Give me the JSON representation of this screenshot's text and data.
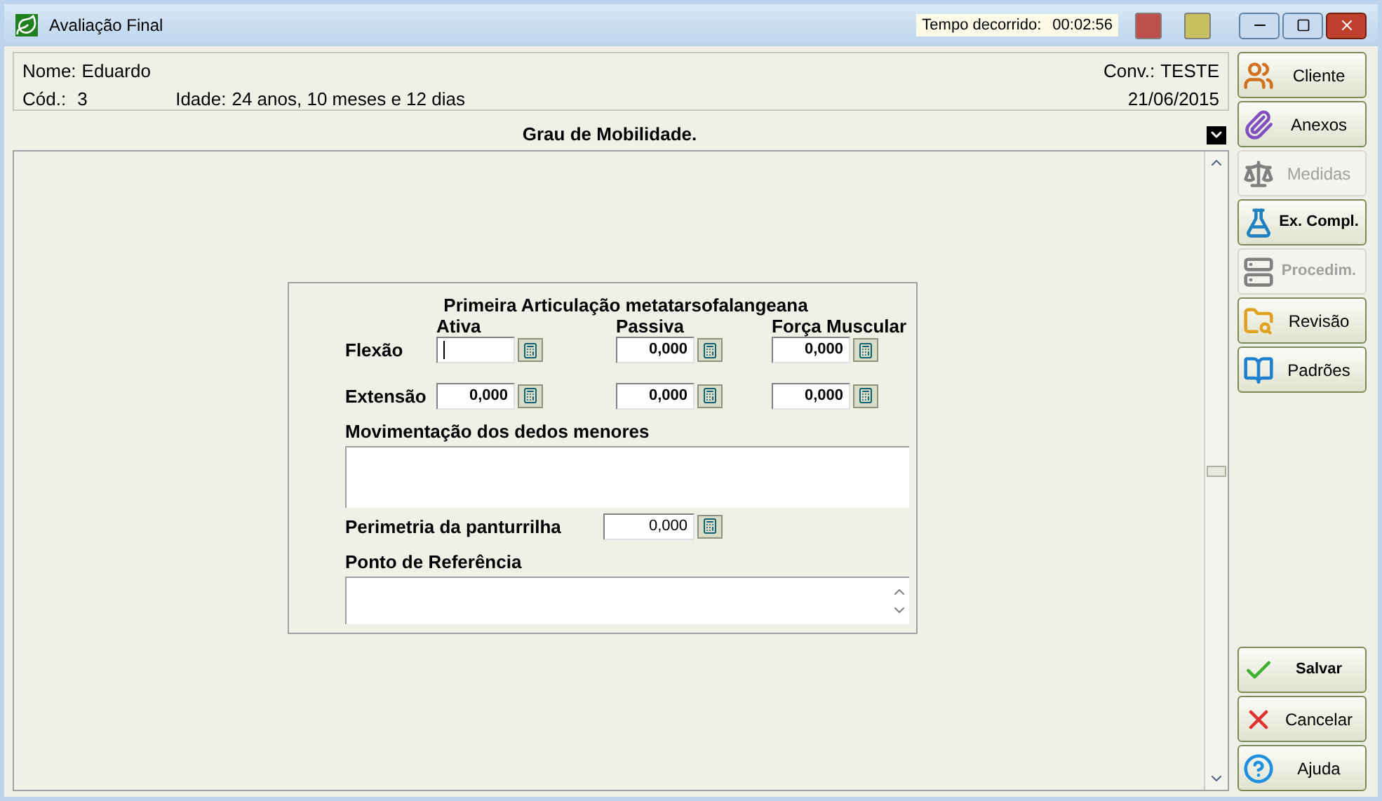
{
  "window": {
    "title": "Avaliação Final"
  },
  "timer": {
    "label": "Tempo decorrido:",
    "value": "00:02:56"
  },
  "indicators": [
    {
      "color": "#c0504d"
    },
    {
      "color": "#c8c060"
    }
  ],
  "patient": {
    "name_label": "Nome:",
    "name": "Eduardo",
    "code_label": "Cód.:",
    "code": "3",
    "age_label": "Idade:",
    "age": "24 anos, 10 meses e 12 dias",
    "conv_label": "Conv.:",
    "conv": "TESTE",
    "date": "21/06/2015"
  },
  "section": {
    "title": "Grau de Mobilidade."
  },
  "form": {
    "title": "Primeira Articulação metatarsofalangeana",
    "columns": [
      "Ativa",
      "Passiva",
      "Força Muscular"
    ],
    "rows": [
      {
        "label": "Flexão",
        "cells": [
          {
            "focused": true
          },
          {
            "value": "0,000",
            "focused": false
          },
          {
            "value": "0,000",
            "focused": false
          }
        ]
      },
      {
        "label": "Extensão",
        "cells": [
          {
            "value": "0,000",
            "focused": false
          },
          {
            "value": "0,000",
            "focused": false
          },
          {
            "value": "0,000",
            "focused": false
          }
        ]
      }
    ],
    "movement": {
      "label": "Movimentação dos dedos menores"
    },
    "perimetry": {
      "label": "Perimetria da panturrilha",
      "value": "0,000"
    },
    "reference": {
      "label": "Ponto de Referência"
    }
  },
  "side_buttons": [
    {
      "kind": "client",
      "label": "Cliente",
      "disabled": false,
      "bold": false
    },
    {
      "kind": "attachments",
      "label": "Anexos",
      "disabled": false,
      "bold": false
    },
    {
      "kind": "measures",
      "label": "Medidas",
      "disabled": true,
      "bold": false
    },
    {
      "kind": "exams",
      "label": "Ex. Compl.",
      "disabled": false,
      "bold": true
    },
    {
      "kind": "procedures",
      "label": "Procedim.",
      "disabled": true,
      "bold": true
    },
    {
      "kind": "review",
      "label": "Revisão",
      "disabled": false,
      "bold": false
    },
    {
      "kind": "standards",
      "label": "Padrões",
      "disabled": false,
      "bold": false
    }
  ],
  "action_buttons": [
    {
      "kind": "save",
      "label": "Salvar",
      "bold": true
    },
    {
      "kind": "cancel",
      "label": "Cancelar",
      "bold": false
    },
    {
      "kind": "help",
      "label": "Ajuda",
      "bold": false
    }
  ]
}
